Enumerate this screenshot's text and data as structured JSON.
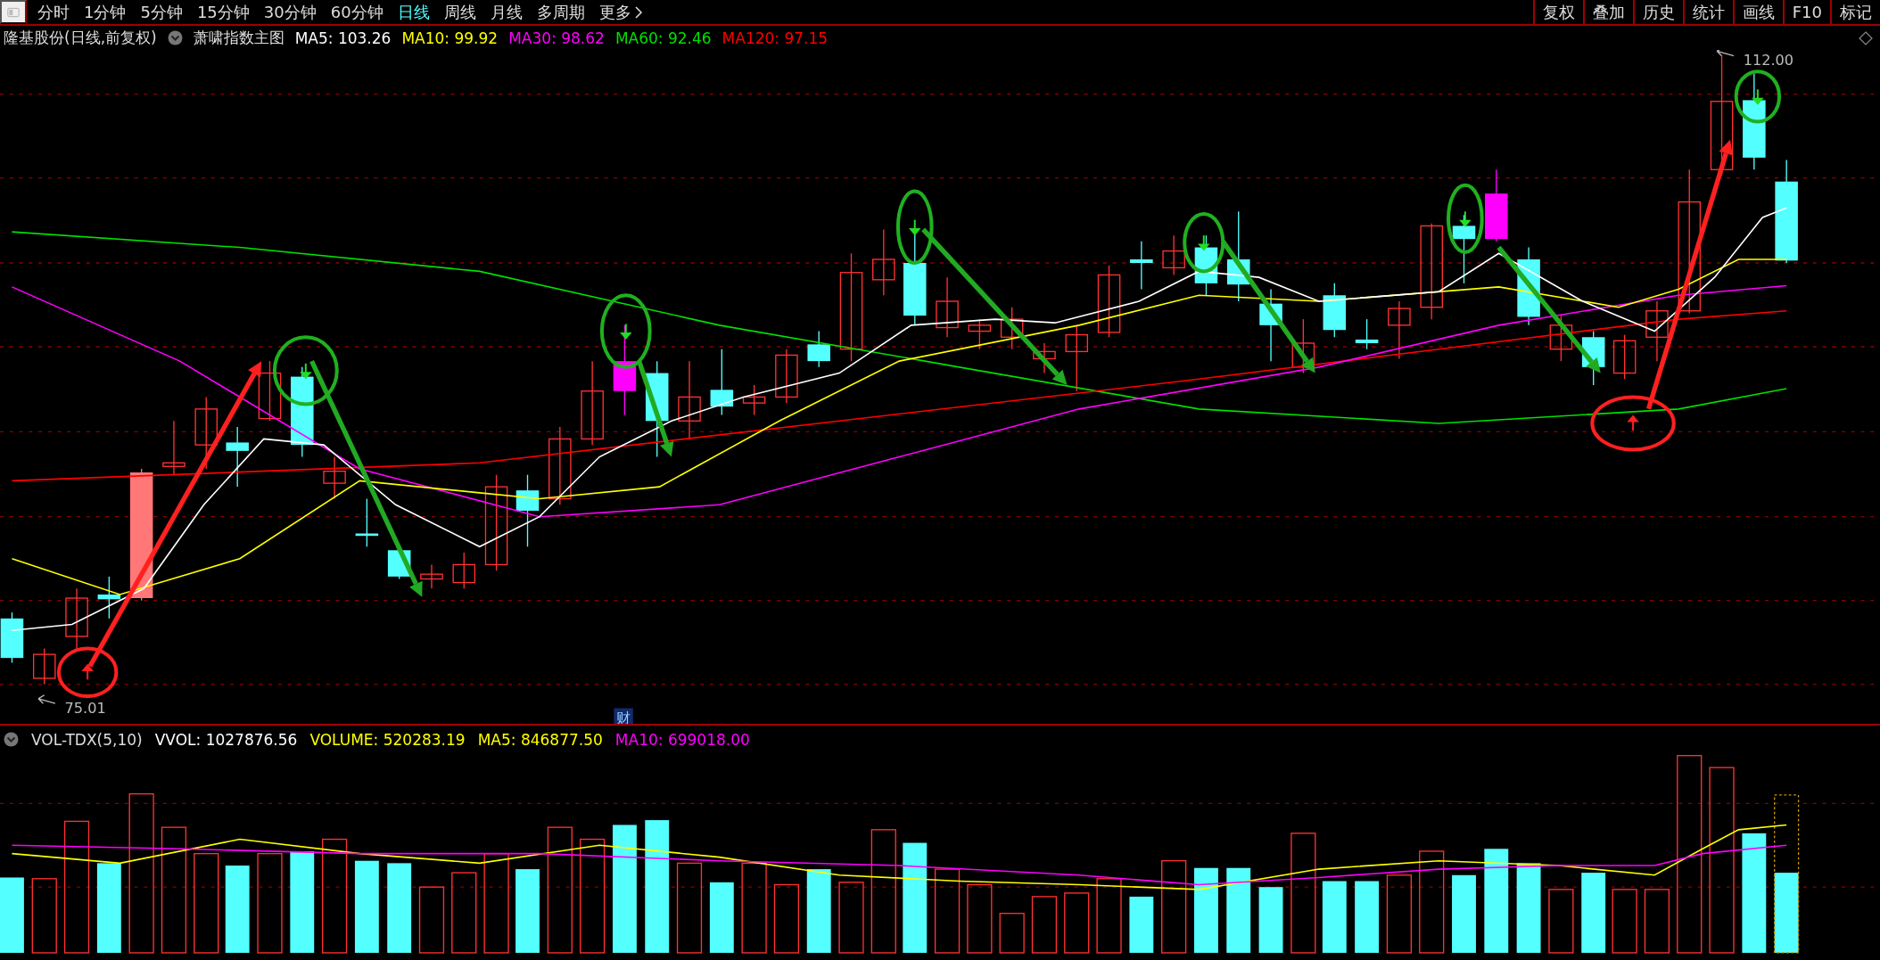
{
  "toolbar": {
    "periods": [
      {
        "label": "分时",
        "selected": false
      },
      {
        "label": "1分钟",
        "selected": false
      },
      {
        "label": "5分钟",
        "selected": false
      },
      {
        "label": "15分钟",
        "selected": false
      },
      {
        "label": "30分钟",
        "selected": false
      },
      {
        "label": "60分钟",
        "selected": false
      },
      {
        "label": "日线",
        "selected": true
      },
      {
        "label": "周线",
        "selected": false
      },
      {
        "label": "月线",
        "selected": false
      },
      {
        "label": "多周期",
        "selected": false
      }
    ],
    "more": "更多",
    "tools": [
      "复权",
      "叠加",
      "历史",
      "统计",
      "画线",
      "F10",
      "标记"
    ]
  },
  "main_chart": {
    "title": "隆基股份(日线,前复权)",
    "indicator": "萧啸指数主图",
    "ma_legend": [
      {
        "label": "MA5: 103.26",
        "color": "#ffffff"
      },
      {
        "label": "MA10: 99.92",
        "color": "#ffff00"
      },
      {
        "label": "MA30: 98.62",
        "color": "#ff00ff"
      },
      {
        "label": "MA60: 92.46",
        "color": "#00e000"
      },
      {
        "label": "MA120: 97.15",
        "color": "#ff0000"
      }
    ],
    "high_label": "112.00",
    "low_label": "75.01",
    "finance_marker": "财"
  },
  "volume_panel": {
    "indicator": "VOL-TDX(5,10)",
    "readings": [
      {
        "label": "VVOL: 1027876.56",
        "color": "#ffffff"
      },
      {
        "label": "VOLUME: 520283.19",
        "color": "#ffff00"
      },
      {
        "label": "MA5: 846877.50",
        "color": "#ffff00"
      },
      {
        "label": "MA10: 699018.00",
        "color": "#ff00ff"
      }
    ]
  }
}
